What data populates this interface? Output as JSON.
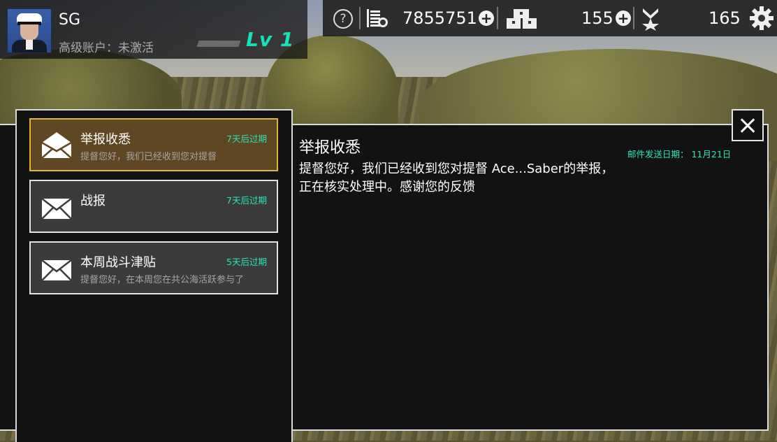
{
  "player": {
    "name": "SG",
    "account_status": "高级账户：未激活",
    "level": "Lv 1"
  },
  "resources": {
    "coins": "7855751",
    "crates": "155",
    "medals": "165"
  },
  "mail": {
    "items": [
      {
        "subject": "举报收悉",
        "preview": "提督您好，我们已经收到您对提督",
        "expiry": "7天后过期",
        "selected": true
      },
      {
        "subject": "战报",
        "preview": "",
        "expiry": "7天后过期",
        "selected": false
      },
      {
        "subject": "本周战斗津贴",
        "preview": "提督您好，在本周您在共公海活跃参与了",
        "expiry": "5天后过期",
        "selected": false
      }
    ],
    "detail": {
      "title": "举报收悉",
      "date": "邮件发送日期：  11月21日",
      "body": "提督您好，我们已经收到您对提督 Ace...Saber的举报，正在核实处理中。感谢您的反馈"
    }
  },
  "colors": {
    "accent_teal": "#2be6b5",
    "selected_border": "#e3b23a",
    "selected_bg": "#5e4722"
  },
  "icons": [
    "help-icon",
    "coins-icon",
    "plus-icon",
    "crates-icon",
    "medal-icon",
    "gear-icon",
    "envelope-icon",
    "close-icon"
  ]
}
